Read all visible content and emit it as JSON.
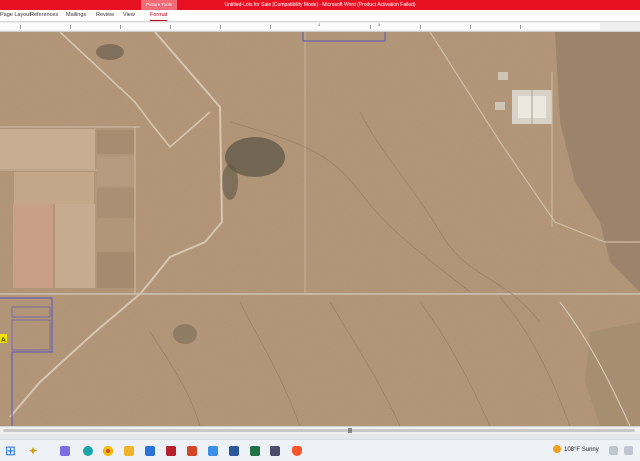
{
  "window": {
    "title": "Untitled-Lots for Sale [Compatibility Mode] - Microsoft Word (Product Activation Failed)",
    "contextual_tab_group": "Picture Tools"
  },
  "ribbon": {
    "tabs": [
      {
        "label": "Page Layout",
        "active": false
      },
      {
        "label": "References",
        "active": false
      },
      {
        "label": "Mailings",
        "active": false
      },
      {
        "label": "Review",
        "active": false
      },
      {
        "label": "View",
        "active": false
      },
      {
        "label": "Format",
        "active": true
      }
    ]
  },
  "ruler": {
    "numbers": [
      "1",
      "2",
      "3",
      "4",
      "5",
      "6"
    ]
  },
  "document": {
    "content": "aerial-satellite-map-image",
    "marker_label": "A"
  },
  "taskbar": {
    "icons": [
      "windows-start-icon",
      "search-icon",
      "copilot-icon",
      "edge-icon",
      "chrome-icon",
      "file-explorer-icon",
      "store-icon",
      "access-icon",
      "powerpoint-icon",
      "photos-icon",
      "word-icon",
      "excel-icon",
      "media-icon",
      "brave-icon"
    ],
    "weather_temp": "108°F",
    "weather_condition": "Sunny",
    "colors": {
      "accent": "#e81123",
      "taskbar": "#eef1f5"
    }
  }
}
